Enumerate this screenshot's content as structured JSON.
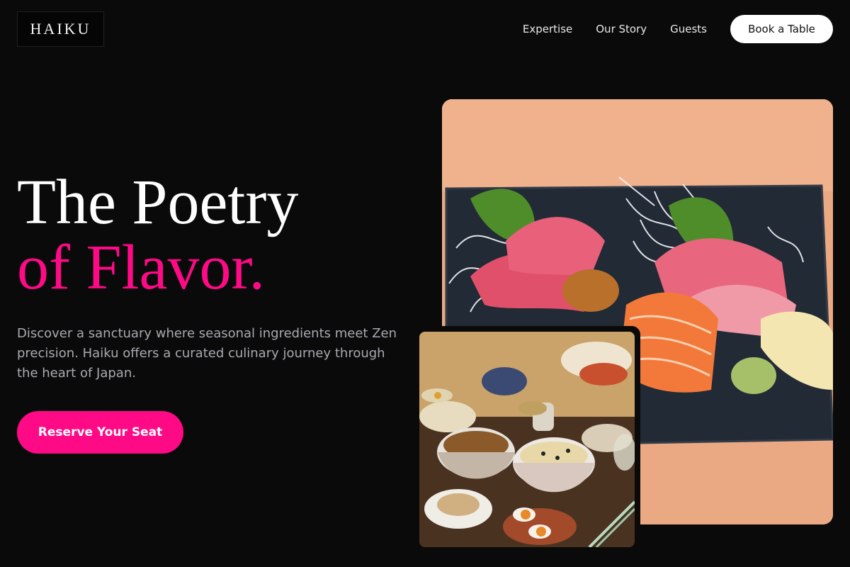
{
  "brand": {
    "name": "HAIKU"
  },
  "nav": {
    "links": [
      "Expertise",
      "Our Story",
      "Guests"
    ],
    "cta_label": "Book a Table"
  },
  "hero": {
    "headline_line1": "The Poetry",
    "headline_line2": "of Flavor.",
    "description": "Discover a sanctuary where seasonal ingredients meet Zen precision. Haiku offers a curated culinary journey through the heart of Japan.",
    "cta_label": "Reserve Your Seat"
  },
  "colors": {
    "background": "#0a0a0a",
    "accent": "#ff0a86",
    "text_muted": "#a9a9b0",
    "button_light": "#ffffff"
  },
  "images": {
    "main": "sashimi-platter-photo",
    "secondary": "japanese-set-meal-photo"
  }
}
